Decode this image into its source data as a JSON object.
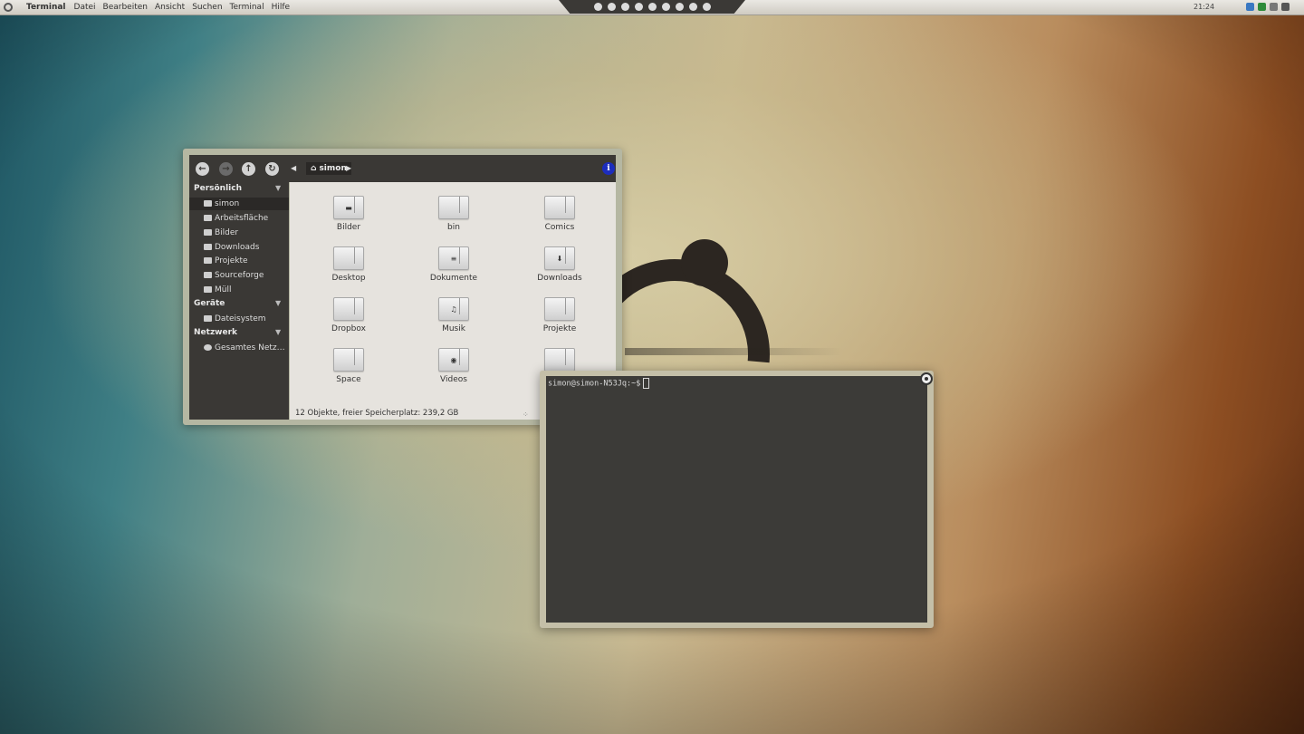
{
  "panel": {
    "app_name": "Terminal",
    "menus": [
      "Datei",
      "Bearbeiten",
      "Ansicht",
      "Suchen",
      "Terminal",
      "Hilfe"
    ],
    "clock": "21:24"
  },
  "file_manager": {
    "path_label": "simon",
    "sidebar": {
      "sections": [
        {
          "title": "Persönlich",
          "items": [
            "simon",
            "Arbeitsfläche",
            "Bilder",
            "Downloads",
            "Projekte",
            "Sourceforge",
            "Müll"
          ]
        },
        {
          "title": "Geräte",
          "items": [
            "Dateisystem"
          ]
        },
        {
          "title": "Netzwerk",
          "items": [
            "Gesamtes Netz…"
          ]
        }
      ]
    },
    "items": [
      {
        "name": "Bilder",
        "glyph": "▬"
      },
      {
        "name": "bin",
        "glyph": ""
      },
      {
        "name": "Comics",
        "glyph": ""
      },
      {
        "name": "Desktop",
        "glyph": ""
      },
      {
        "name": "Dokumente",
        "glyph": "≡"
      },
      {
        "name": "Downloads",
        "glyph": "⬇"
      },
      {
        "name": "Dropbox",
        "glyph": ""
      },
      {
        "name": "Musik",
        "glyph": "♫"
      },
      {
        "name": "Projekte",
        "glyph": ""
      },
      {
        "name": "Space",
        "glyph": ""
      },
      {
        "name": "Videos",
        "glyph": "◉"
      },
      {
        "name": "",
        "glyph": ""
      }
    ],
    "status": "12 Objekte, freier Speicherplatz: 239,2 GB"
  },
  "terminal": {
    "prompt": "simon@simon-N53Jq:~$"
  }
}
